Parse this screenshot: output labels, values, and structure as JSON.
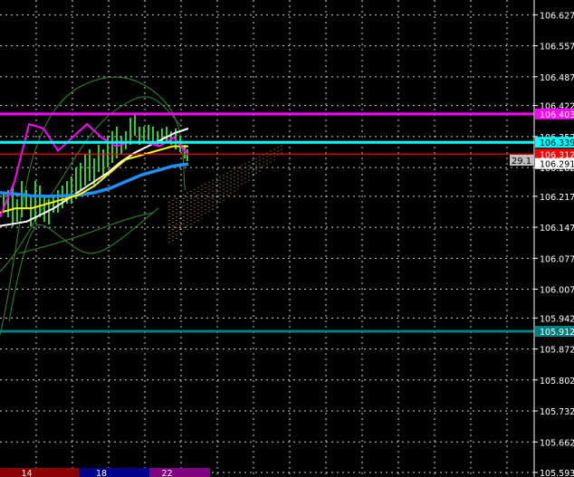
{
  "chart_data": {
    "type": "line",
    "ylim": [
      105.593,
      106.64
    ],
    "y_ticks": [
      "106.627",
      "106.557",
      "106.487",
      "106.422",
      "106.352",
      "106.282",
      "106.217",
      "106.147",
      "106.077",
      "106.007",
      "105.942",
      "105.872",
      "105.802",
      "105.732",
      "105.662",
      "105.593"
    ],
    "grid": true,
    "horizontal_lines": [
      {
        "value": 106.403,
        "label": "106.403",
        "color": "#ff00ff"
      },
      {
        "value": 106.339,
        "label": "106.339",
        "color": "#00ffff"
      },
      {
        "value": 106.312,
        "label": "106.312",
        "color": "#ff0000"
      },
      {
        "value": 106.291,
        "label": "106.291",
        "color": "#ffffff"
      },
      {
        "value": 105.912,
        "label": "105.912",
        "color": "#008080"
      }
    ],
    "price_box_label": "29.1",
    "time_labels": [
      {
        "label": "14",
        "color": "#8b0000"
      },
      {
        "label": "18",
        "color": "#00008b"
      },
      {
        "label": "22",
        "color": "#800080"
      }
    ],
    "series": [
      {
        "color": "#ffffff",
        "values": [
          106.15,
          106.155,
          106.16,
          106.175,
          106.19,
          106.21,
          106.23,
          106.25,
          106.27,
          106.295,
          106.315,
          106.33,
          106.345,
          106.36,
          106.37
        ]
      },
      {
        "color": "#1e90ff",
        "values": [
          106.225,
          106.222,
          106.218,
          106.217,
          106.218,
          106.22,
          106.225,
          106.235,
          106.25,
          106.265,
          106.275,
          106.285,
          106.29
        ]
      },
      {
        "color": "#ffff00",
        "values": [
          106.18,
          106.19,
          106.19,
          106.2,
          106.21,
          106.22,
          106.24,
          106.27,
          106.3,
          106.31,
          106.32,
          106.33,
          106.33
        ]
      },
      {
        "color": "#ff00ff",
        "values": [
          106.17,
          106.25,
          106.38,
          106.37,
          106.32,
          106.35,
          106.38,
          106.35,
          106.33,
          106.34,
          106.34,
          106.33,
          106.35,
          106.31
        ]
      }
    ]
  }
}
